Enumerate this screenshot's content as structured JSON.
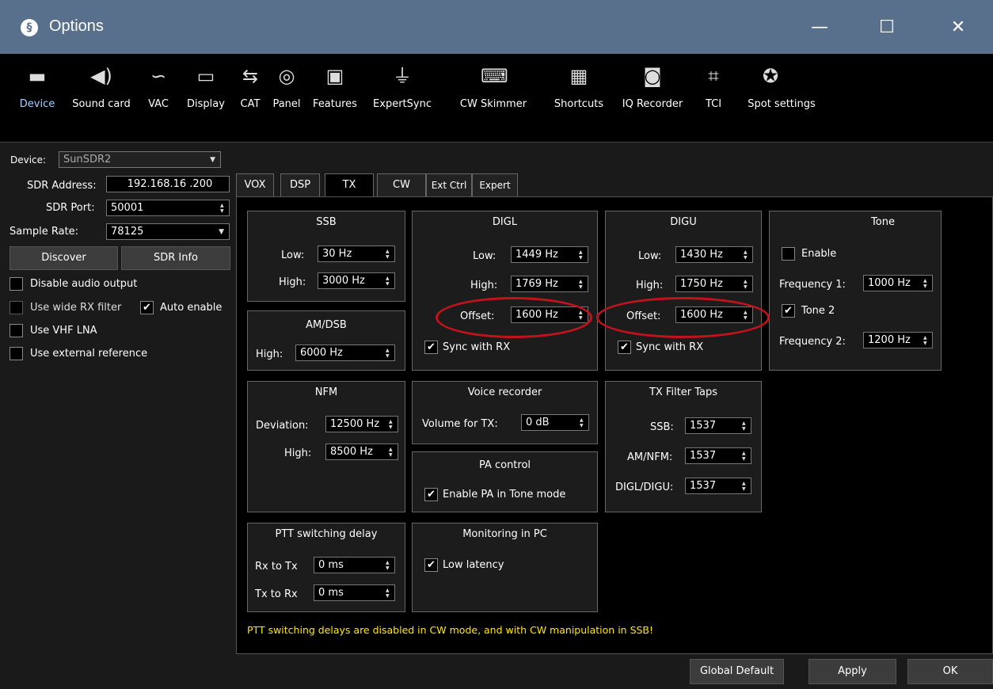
{
  "window": {
    "title": "Options",
    "icon": "app-logo-icon"
  },
  "toolbar": [
    "Device",
    "Sound card",
    "VAC",
    "Display",
    "CAT",
    "Panel",
    "Features",
    "ExpertSync",
    "CW Skimmer",
    "Shortcuts",
    "IQ Recorder",
    "TCI",
    "Spot settings"
  ],
  "left": {
    "device_label": "Device:",
    "device_value": "SunSDR2",
    "addr_label": "SDR Address:",
    "addr_value": "192.168.16 .200",
    "port_label": "SDR Port:",
    "port_value": "50001",
    "rate_label": "Sample Rate:",
    "rate_value": "78125",
    "discover": "Discover",
    "sdr_info": "SDR Info",
    "disable_audio": "Disable audio output",
    "wide_rx": "Use wide RX filter",
    "auto_enable": "Auto enable",
    "vhf_lna": "Use VHF LNA",
    "ext_ref": "Use external reference"
  },
  "tabs": [
    "VOX",
    "DSP",
    "TX",
    "CW",
    "Ext Ctrl",
    "Expert"
  ],
  "ssb": {
    "title": "SSB",
    "low_label": "Low:",
    "low": "30 Hz",
    "high_label": "High:",
    "high": "3000 Hz"
  },
  "amdsb": {
    "title": "AM/DSB",
    "high_label": "High:",
    "high": "6000 Hz"
  },
  "digl": {
    "title": "DIGL",
    "low_label": "Low:",
    "low": "1449 Hz",
    "high_label": "High:",
    "high": "1769 Hz",
    "offset_label": "Offset:",
    "offset": "1600 Hz",
    "sync": "Sync with RX"
  },
  "digu": {
    "title": "DIGU",
    "low_label": "Low:",
    "low": "1430 Hz",
    "high_label": "High:",
    "high": "1750 Hz",
    "offset_label": "Offset:",
    "offset": "1600 Hz",
    "sync": "Sync with RX"
  },
  "tone": {
    "title": "Tone",
    "enable": "Enable",
    "f1_label": "Frequency 1:",
    "f1": "1000 Hz",
    "tone2": "Tone 2",
    "f2_label": "Frequency 2:",
    "f2": "1200 Hz"
  },
  "nfm": {
    "title": "NFM",
    "dev_label": "Deviation:",
    "dev": "12500 Hz",
    "high_label": "High:",
    "high": "8500 Hz"
  },
  "voice": {
    "title": "Voice recorder",
    "vol_label": "Volume for TX:",
    "vol": "0 dB"
  },
  "pa": {
    "title": "PA control",
    "enable": "Enable PA in Tone mode"
  },
  "taps": {
    "title": "TX Filter Taps",
    "ssb_label": "SSB:",
    "ssb": "1537",
    "am_label": "AM/NFM:",
    "am": "1537",
    "dig_label": "DIGL/DIGU:",
    "dig": "1537"
  },
  "ptt": {
    "title": "PTT switching delay",
    "rx_label": "Rx to Tx",
    "rx": "0 ms",
    "tx_label": "Tx to Rx",
    "tx": "0 ms"
  },
  "mon": {
    "title": "Monitoring in PC",
    "low_latency": "Low latency"
  },
  "warning": "PTT switching delays are disabled in CW mode, and with CW manipulation in SSB!",
  "buttons": {
    "global": "Global Default",
    "apply": "Apply",
    "ok": "OK"
  },
  "check_glyph": "✔",
  "accent": "#58708c",
  "highlight": "#c2121c"
}
